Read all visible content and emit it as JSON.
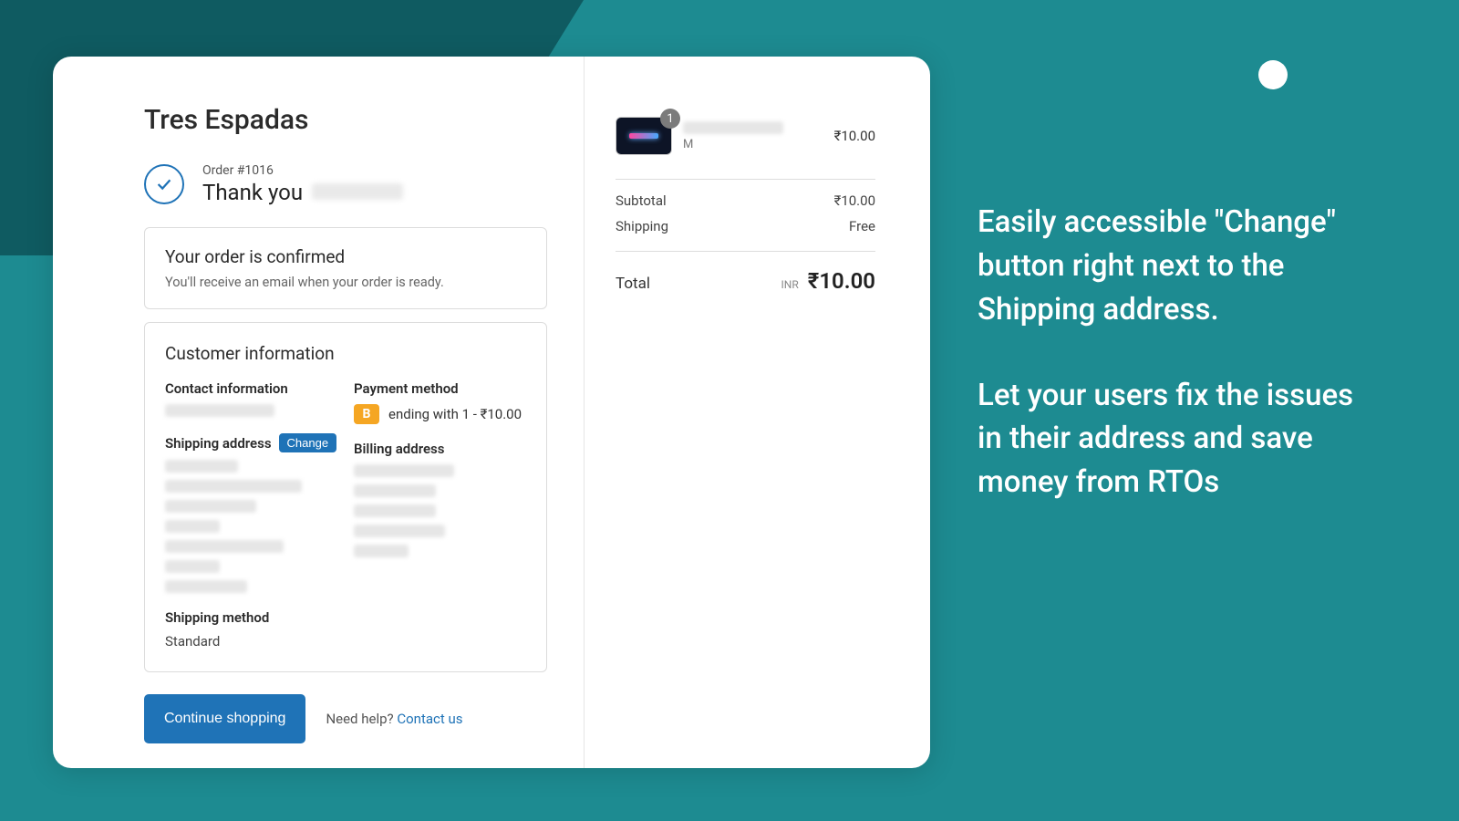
{
  "store": {
    "name": "Tres Espadas"
  },
  "order": {
    "number_label": "Order #1016",
    "thank_you": "Thank you",
    "confirmed_title": "Your order is confirmed",
    "confirmed_sub": "You'll receive an email when your order is ready."
  },
  "customer": {
    "panel_title": "Customer information",
    "contact_heading": "Contact information",
    "shipping_heading": "Shipping address",
    "change_label": "Change",
    "shipping_method_heading": "Shipping method",
    "shipping_method_value": "Standard",
    "payment_heading": "Payment method",
    "payment_badge": "B",
    "payment_text": "ending with 1 - ₹10.00",
    "billing_heading": "Billing address"
  },
  "footer": {
    "continue": "Continue shopping",
    "need_help": "Need help?",
    "contact": "Contact us"
  },
  "cart": {
    "item": {
      "qty": "1",
      "variant": "M",
      "price": "₹10.00"
    },
    "subtotal_label": "Subtotal",
    "subtotal_value": "₹10.00",
    "shipping_label": "Shipping",
    "shipping_value": "Free",
    "total_label": "Total",
    "currency": "INR",
    "total_value": "₹10.00"
  },
  "promo": {
    "p1": "Easily accessible \"Change\" button right next to the Shipping address.",
    "p2": "Let your users fix the issues in their address and save money from RTOs"
  }
}
